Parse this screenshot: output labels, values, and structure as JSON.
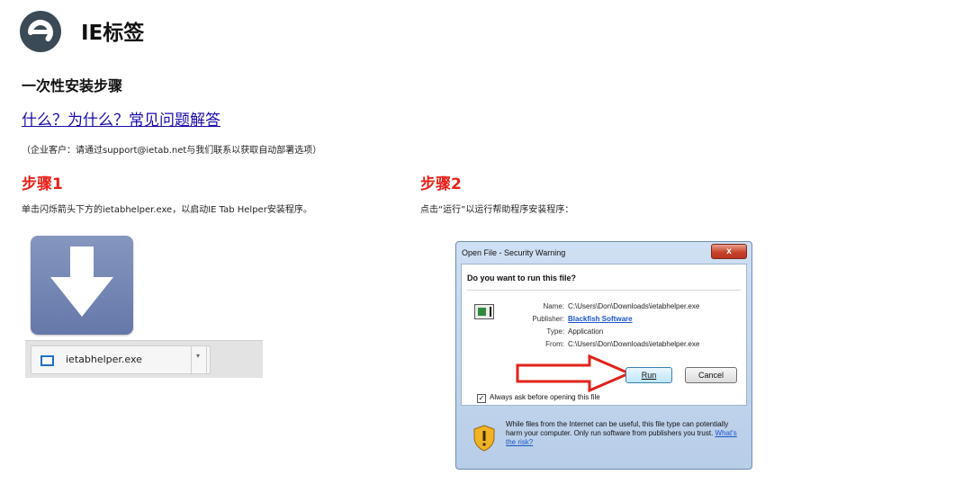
{
  "header": {
    "title": "IE标签"
  },
  "section": {
    "title": "一次性安装步骤"
  },
  "faq": {
    "link": "什么？为什么？常见问题解答"
  },
  "note": {
    "text": "（企业客户：请通过support@ietab.net与我们联系以获取自动部署选项）"
  },
  "step1": {
    "title": "步骤1",
    "desc": "单击闪烁箭头下方的ietabhelper.exe，以启动IE Tab Helper安装程序。",
    "download_file": "ietabhelper.exe"
  },
  "step2": {
    "title": "步骤2",
    "desc": "点击“运行”以运行帮助程序安装程序：",
    "dialog": {
      "title": "Open File - Security Warning",
      "close": "x",
      "question": "Do you want to run this file?",
      "fields": {
        "name_label": "Name:",
        "name_value": "C:\\Users\\Don\\Downloads\\ietabhelper.exe",
        "publisher_label": "Publisher:",
        "publisher_value": "Blackfish Software",
        "type_label": "Type:",
        "type_value": "Application",
        "from_label": "From:",
        "from_value": "C:\\Users\\Don\\Downloads\\ietabhelper.exe"
      },
      "run": "Run",
      "cancel": "Cancel",
      "checkbox": "Always ask before opening this file",
      "warning": "While files from the Internet can be useful, this file type can potentially harm your computer. Only run software from publishers you trust.",
      "risk_link": "What's the risk?"
    }
  },
  "colors": {
    "accent_red": "#e8211a",
    "link": "#1a0dab",
    "logo": "#3a4a56"
  }
}
